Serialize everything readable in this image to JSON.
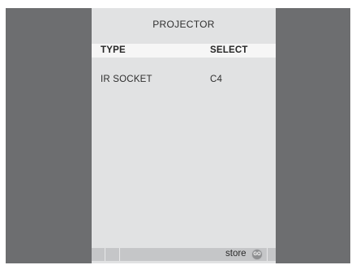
{
  "menu": {
    "title": "PROJECTOR",
    "columns": {
      "type": "TYPE",
      "select": "SELECT"
    },
    "rows": [
      {
        "type": "IR SOCKET",
        "select": "C4"
      }
    ]
  },
  "footer": {
    "action_label": "store",
    "button_label": "GO",
    "button_icon": "go-button-icon"
  },
  "colors": {
    "background": "#6d6e70",
    "panel": "#e1e2e3",
    "header_row": "#f6f6f6",
    "footer_bar": "#c5c6c8"
  }
}
